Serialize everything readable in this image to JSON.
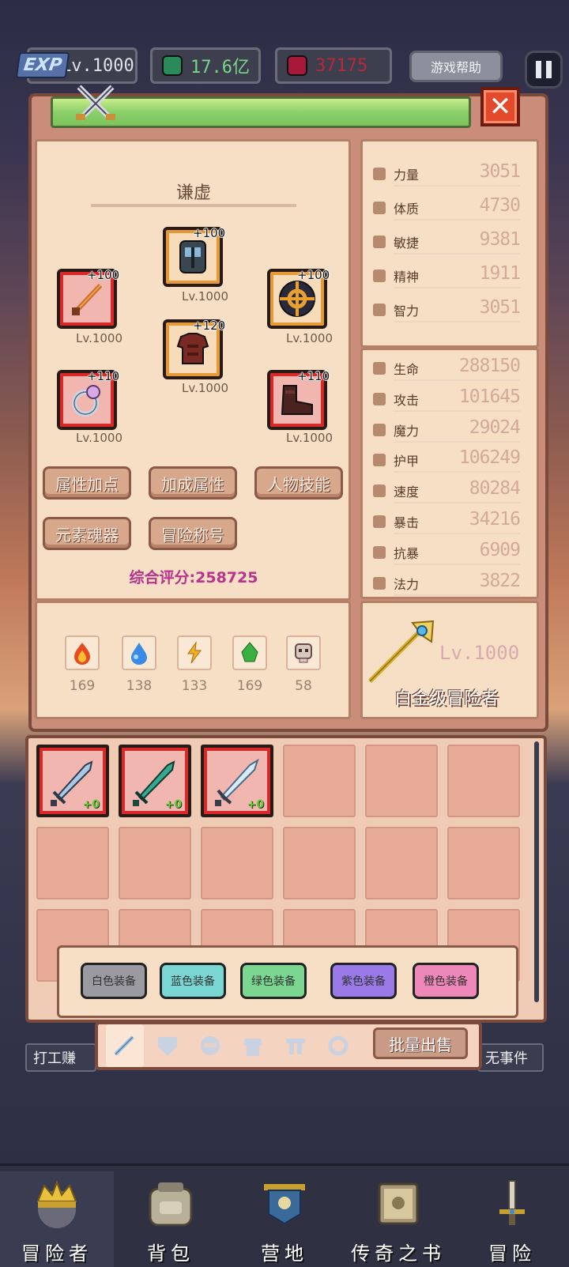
{
  "topbar": {
    "exp_badge": "EXP",
    "level": "Lv.1000",
    "gold": "17.6亿",
    "gems": "37175",
    "help_label": "游戏帮助"
  },
  "character": {
    "name": "谦虚",
    "score_label": "综合评分:258725"
  },
  "equipment": {
    "helmet": {
      "plus": "+100",
      "level": "Lv.1000"
    },
    "weapon": {
      "plus": "+100",
      "level": "Lv.1000"
    },
    "offhand": {
      "plus": "+100",
      "level": "Lv.1000"
    },
    "armor": {
      "plus": "+120",
      "level": "Lv.1000"
    },
    "ring": {
      "plus": "+110",
      "level": "Lv.1000"
    },
    "boots": {
      "plus": "+110",
      "level": "Lv.1000"
    }
  },
  "buttons": {
    "attr_points": "属性加点",
    "bonus_attr": "加成属性",
    "skills": "人物技能",
    "soul": "元素魂器",
    "titles": "冒险称号"
  },
  "elements": [
    {
      "name": "fire",
      "value": "169",
      "color": "#e84a20"
    },
    {
      "name": "water",
      "value": "138",
      "color": "#3a8ae8"
    },
    {
      "name": "lightning",
      "value": "133",
      "color": "#f0b020"
    },
    {
      "name": "earth",
      "value": "169",
      "color": "#3ab040"
    },
    {
      "name": "dark",
      "value": "58",
      "color": "#8a6a6a"
    }
  ],
  "base_stats": [
    {
      "label": "力量",
      "value": "3051"
    },
    {
      "label": "体质",
      "value": "4730"
    },
    {
      "label": "敏捷",
      "value": "9381"
    },
    {
      "label": "精神",
      "value": "1911"
    },
    {
      "label": "智力",
      "value": "3051"
    }
  ],
  "combat_stats": [
    {
      "label": "生命",
      "value": "288150"
    },
    {
      "label": "攻击",
      "value": "101645"
    },
    {
      "label": "魔力",
      "value": "29024"
    },
    {
      "label": "护甲",
      "value": "106249"
    },
    {
      "label": "速度",
      "value": "80284"
    },
    {
      "label": "暴击",
      "value": "34216"
    },
    {
      "label": "抗暴",
      "value": "6909"
    },
    {
      "label": "法力",
      "value": "3822"
    }
  ],
  "rank": {
    "level": "Lv.1000",
    "title": "白金级冒险者"
  },
  "inventory": {
    "items": [
      {
        "plus": "+0",
        "color": "#a8c8e8"
      },
      {
        "plus": "+0",
        "color": "#3aa890"
      },
      {
        "plus": "+0",
        "color": "#c8e4f4"
      }
    ]
  },
  "filters": [
    {
      "label": "白色装备",
      "color": "#9a9aa0"
    },
    {
      "label": "蓝色装备",
      "color": "#7ad6d2"
    },
    {
      "label": "绿色装备",
      "color": "#7ad690"
    },
    {
      "label": "紫色装备",
      "color": "#9a7ae8"
    },
    {
      "label": "橙色装备",
      "color": "#ee88b8"
    }
  ],
  "bulk_sell": "批量出售",
  "side_left": "打工赚",
  "side_right": "无事件",
  "nav": [
    {
      "label": "冒险者"
    },
    {
      "label": "背包"
    },
    {
      "label": "营地"
    },
    {
      "label": "传奇之书"
    },
    {
      "label": "冒险"
    }
  ]
}
